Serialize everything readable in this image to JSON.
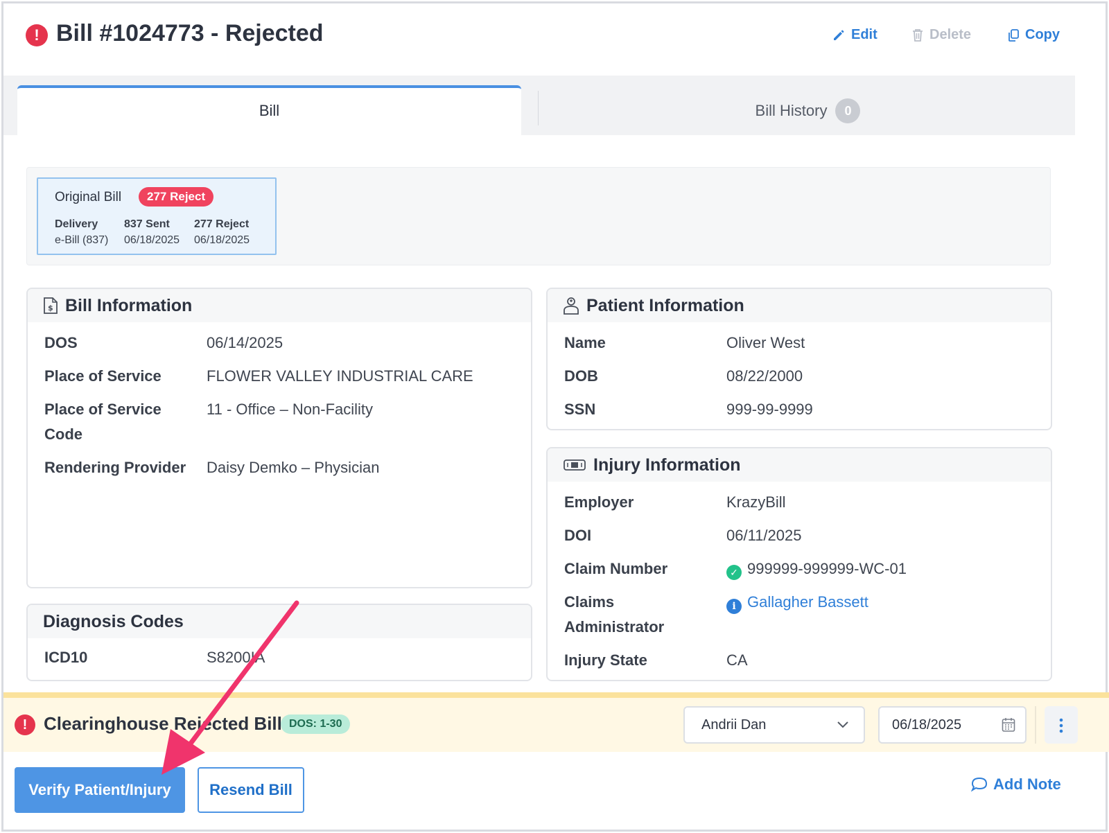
{
  "header": {
    "alert_icon": "!",
    "title": "Bill #1024773 - Rejected",
    "actions": {
      "edit": "Edit",
      "delete": "Delete",
      "copy": "Copy"
    }
  },
  "tabs": {
    "bill": "Bill",
    "history": "Bill History",
    "history_count": "0"
  },
  "original_bill": {
    "title": "Original Bill",
    "badge": "277 Reject",
    "columns": [
      {
        "heading": "Delivery",
        "value": "e-Bill (837)"
      },
      {
        "heading": "837 Sent",
        "value": "06/18/2025"
      },
      {
        "heading": "277 Reject",
        "value": "06/18/2025"
      }
    ]
  },
  "bill_info": {
    "title": "Bill Information",
    "rows": [
      {
        "label": "DOS",
        "value": "06/14/2025"
      },
      {
        "label": "Place of Service",
        "value": "FLOWER VALLEY INDUSTRIAL CARE"
      },
      {
        "label": "Place of Service",
        "label2": "Code",
        "value": "11 - Office – Non-Facility"
      },
      {
        "label": "Rendering Provider",
        "value": "Daisy Demko – Physician"
      }
    ]
  },
  "diagnosis": {
    "title": "Diagnosis Codes",
    "label": "ICD10",
    "value": "S8200IA"
  },
  "patient_info": {
    "title": "Patient Information",
    "rows": [
      {
        "label": "Name",
        "value": "Oliver West"
      },
      {
        "label": "DOB",
        "value": "08/22/2000"
      },
      {
        "label": "SSN",
        "value": "999-99-9999"
      }
    ]
  },
  "injury_info": {
    "title": "Injury Information",
    "employer_label": "Employer",
    "employer": "KrazyBill",
    "doi_label": "DOI",
    "doi": "06/11/2025",
    "claim_label": "Claim Number",
    "claim": "999999-999999-WC-01",
    "admin_label": "Claims",
    "admin_label2": "Administrator",
    "admin": "Gallagher Bassett",
    "state_label": "Injury State",
    "state": "CA"
  },
  "rejected": {
    "alert_icon": "!",
    "title": "Clearinghouse Rejected Bill",
    "dos_badge": "DOS: 1-30",
    "assignee": "Andrii Dan",
    "date": "06/18/2025"
  },
  "actions": {
    "verify": "Verify Patient/Injury",
    "resend": "Resend Bill",
    "add_note": "Add Note"
  },
  "colors": {
    "accent": "#2f7fd8",
    "danger": "#e5344d",
    "reject_badge": "#f0435e",
    "success": "#22c28a",
    "warning_bg": "#fff8e4",
    "annotation_arrow": "#f0346c"
  }
}
